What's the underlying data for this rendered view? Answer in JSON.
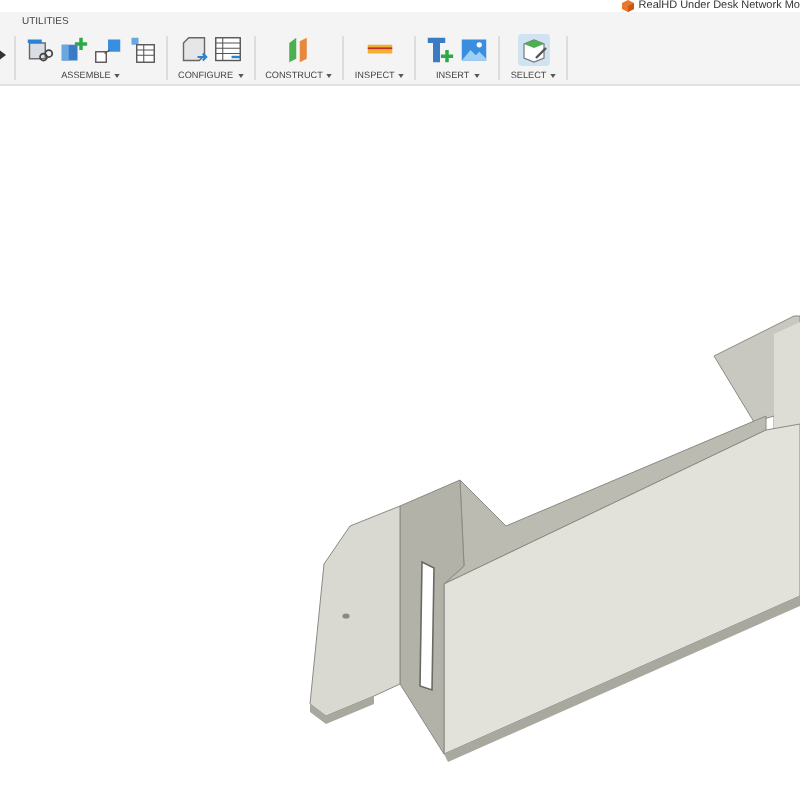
{
  "title_bar": {
    "title": "RealHD Under Desk Network Mo"
  },
  "tab": {
    "label": "UTILITIES"
  },
  "groups": [
    {
      "kind": "assemble",
      "label": "ASSEMBLE"
    },
    {
      "kind": "configure",
      "label": "CONFIGURE"
    },
    {
      "kind": "construct",
      "label": "CONSTRUCT"
    },
    {
      "kind": "inspect",
      "label": "INSPECT"
    },
    {
      "kind": "insert",
      "label": "INSERT"
    },
    {
      "kind": "select",
      "label": "SELECT"
    }
  ]
}
